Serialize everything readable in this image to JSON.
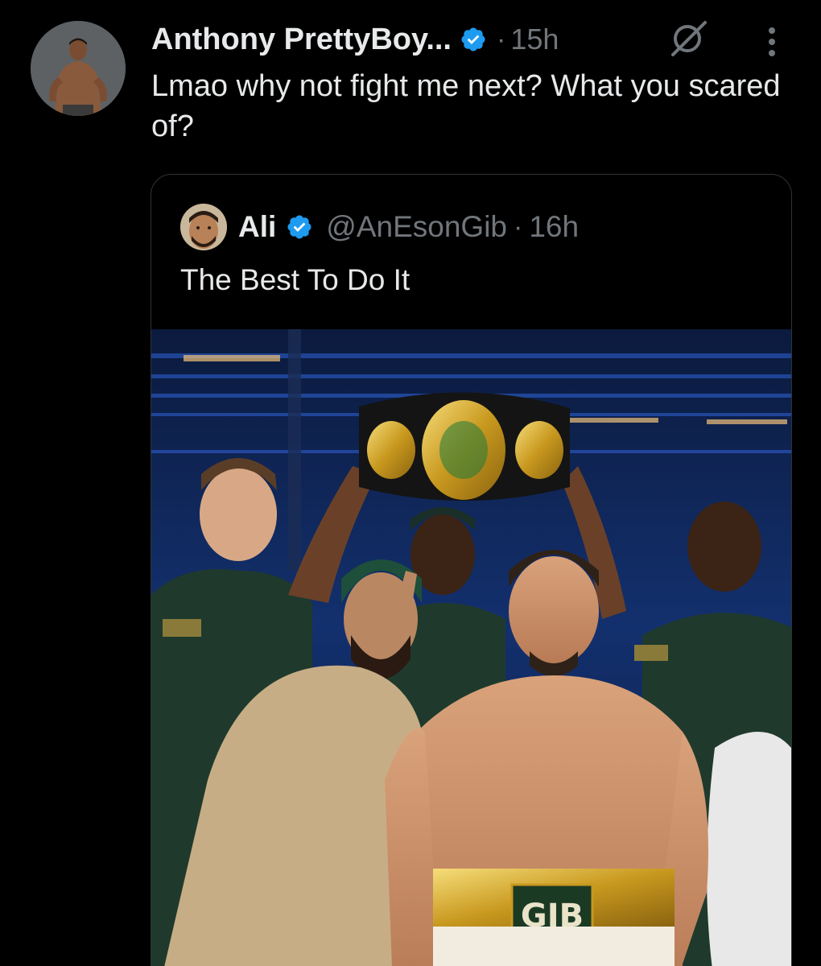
{
  "tweet": {
    "display_name": "Anthony PrettyBoy...",
    "time": "15h",
    "separator": "·",
    "text": "Lmao why not fight me next? What you scared of?",
    "icons": {
      "verified": "verified-badge-icon",
      "grok": "grok-slash-icon",
      "more": "more-vertical-icon"
    }
  },
  "quote": {
    "display_name": "Ali",
    "handle": "@AnEsonGib",
    "time": "16h",
    "separator": "·",
    "text": "The Best To Do It",
    "photo": {
      "trunks_text": "GIB",
      "shirt_logo": "GIB"
    }
  },
  "colors": {
    "background": "#000000",
    "primary_text": "#e7e9ea",
    "secondary_text": "#71767b",
    "verified_blue": "#1d9bf0",
    "card_border": "#2f3336"
  }
}
